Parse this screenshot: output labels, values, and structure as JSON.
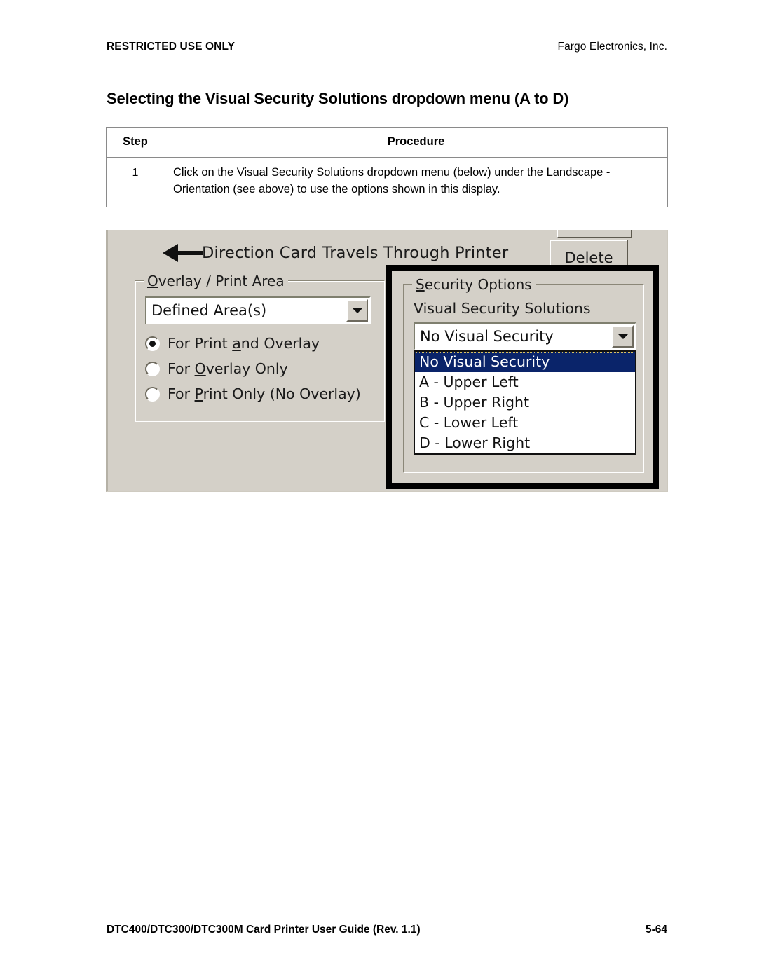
{
  "header": {
    "left": "RESTRICTED USE ONLY",
    "right": "Fargo Electronics, Inc."
  },
  "section": {
    "title": "Selecting the Visual Security Solutions dropdown menu (A to D)"
  },
  "procedure_table": {
    "columns": [
      "Step",
      "Procedure"
    ],
    "rows": [
      {
        "step": "1",
        "procedure": "Click on the Visual Security Solutions dropdown menu (below) under the Landscape - Orientation (see above) to use the options shown in this display."
      }
    ]
  },
  "screenshot": {
    "direction_caption": "Direction Card Travels Through Printer",
    "direction_arrow_icon": "arrow-left-icon",
    "overlay_group": {
      "title_prefix": "O",
      "title_rest": "verlay / Print Area",
      "combo_value": "Defined Area(s)",
      "radios": [
        {
          "pre": "For Print ",
          "key": "a",
          "post": "nd Overlay",
          "checked": true
        },
        {
          "pre": "For ",
          "key": "O",
          "post": "verlay Only",
          "checked": false
        },
        {
          "pre": "For ",
          "key": "P",
          "post": "rint Only (No Overlay)",
          "checked": false
        }
      ]
    },
    "buttons": {
      "delete_label": "Delete"
    },
    "security_group": {
      "title_prefix": "S",
      "title_rest": "ecurity Options",
      "field_label": "Visual Security Solutions",
      "combo_value": "No Visual Security",
      "dropdown_options": [
        "No Visual Security",
        "A - Upper Left",
        "B - Upper Right",
        "C - Lower Left",
        "D - Lower Right"
      ],
      "selected_index": 0
    },
    "colors": {
      "window_face": "#d4d0c8",
      "selection_blue": "#0a246a",
      "callout_black": "#000000"
    }
  },
  "footer": {
    "left": "DTC400/DTC300/DTC300M Card Printer User Guide (Rev. 1.1)",
    "page": "5-64"
  }
}
